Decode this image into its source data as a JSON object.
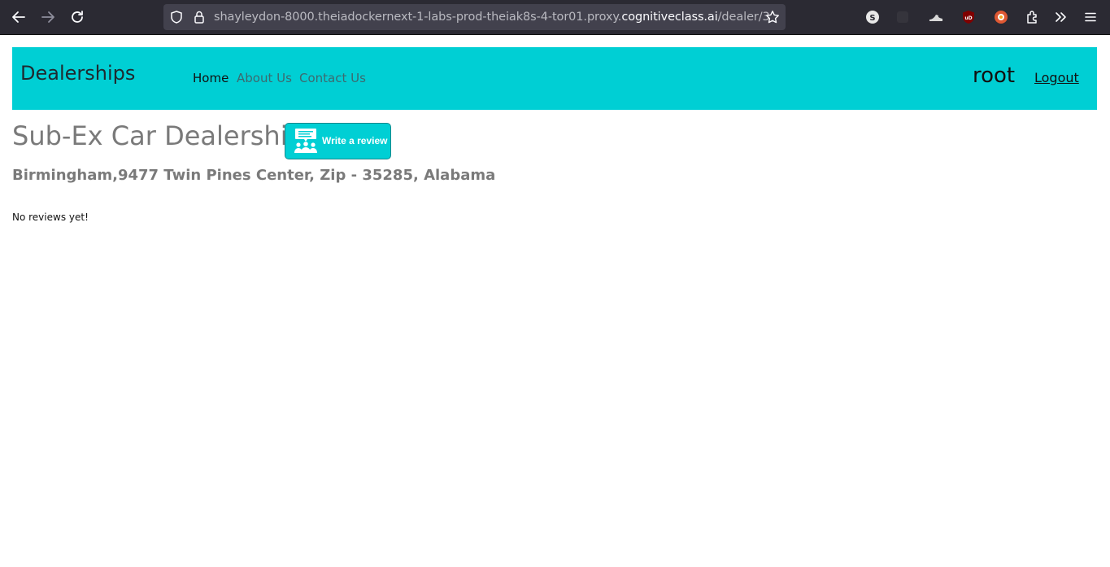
{
  "browser": {
    "url_prefix": "shayleydon-8000.theiadockernext-1-labs-prod-theiak8s-4-tor01.proxy.",
    "url_host": "cognitiveclass.ai",
    "url_path": "/dealer/3"
  },
  "navbar": {
    "brand": "Dealerships",
    "links": [
      {
        "label": "Home"
      },
      {
        "label": "About Us"
      },
      {
        "label": "Contact Us"
      }
    ],
    "user": "root",
    "logout_label": "Logout"
  },
  "dealer": {
    "name": "Sub-Ex Car Dealership",
    "review_button_label": "Write a review",
    "address": "Birmingham,9477 Twin Pines Center, Zip - 35285, Alabama",
    "reviews_message": "No reviews yet!"
  },
  "colors": {
    "accent": "#00cfd4",
    "title_gray": "#7a7a7a"
  }
}
